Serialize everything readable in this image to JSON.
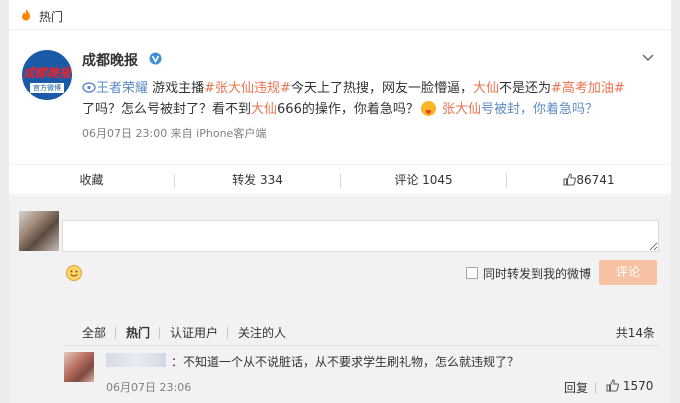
{
  "header": {
    "title": "热门",
    "icon": "flame-icon"
  },
  "post": {
    "username": "成都晚报",
    "avatar_logo": "成都晚报",
    "avatar_sub": "官方微博",
    "verified_icon": "verified-v-icon",
    "content": {
      "link_game": "王者荣耀",
      "t1": " 游戏主播",
      "topic1": "#张大仙违规#",
      "t2": "今天上了热搜，网友一脸懵逼，",
      "red1": "大仙",
      "t3": "不是还为",
      "topic2": "#高考加油#",
      "t4": "了吗？怎么号被封了？看不到",
      "red2": "大仙",
      "t5": "666的操作，你着急吗？",
      "red3": " 张大仙",
      "blue1": "号被封，你着急吗？"
    },
    "meta": "06月07日 23:00 来自 iPhone客户端"
  },
  "actions": {
    "favorite": "收藏",
    "repost": "转发 334",
    "comment": "评论 1045",
    "like": "86741"
  },
  "comment_box": {
    "placeholder": "",
    "forward_label": "同时转发到我的微博",
    "submit": "评论"
  },
  "filters": {
    "all": "全部",
    "hot": "热门",
    "verified": "认证用户",
    "following": "关注的人",
    "count": "共14条"
  },
  "comments": [
    {
      "text": "：不知道一个从不说脏话，从不要求学生刷礼物，怎么就违规了？",
      "time": "06月07日 23:06",
      "reply": "回复",
      "likes": "1570"
    }
  ],
  "colors": {
    "accent": "#eb7350",
    "link": "#5d8bc5",
    "submit_bg": "#f7c1a3"
  }
}
